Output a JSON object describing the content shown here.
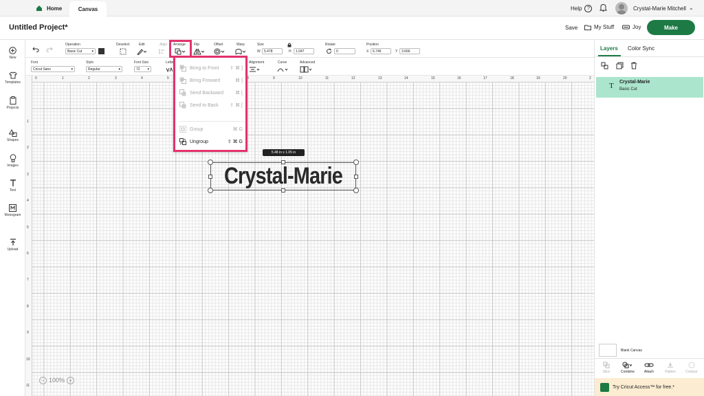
{
  "nav": {
    "home_label": "Home",
    "canvas_label": "Canvas",
    "help_label": "Help",
    "user_name": "Crystal-Marie Mitchell"
  },
  "project": {
    "title": "Untitled Project*",
    "save_label": "Save",
    "mystuff_label": "My Stuff",
    "joy_label": "Joy",
    "make_label": "Make"
  },
  "sidebar": {
    "items": [
      "New",
      "Templates",
      "Projects",
      "Shapes",
      "Images",
      "Text",
      "Monogram",
      "Upload"
    ]
  },
  "toolbar1": {
    "operation_label": "Operation",
    "operation_value": "Basic Cut",
    "deselect_label": "Deselect",
    "edit_label": "Edit",
    "align_label": "Align",
    "arrange_label": "Arrange",
    "flip_label": "Flip",
    "offset_label": "Offset",
    "warp_label": "Warp",
    "size_label": "Size",
    "w_label": "W",
    "w_value": "5.478",
    "h_label": "H",
    "h_value": "1.047",
    "rotate_label": "Rotate",
    "rotate_value": "0",
    "position_label": "Position",
    "x_label": "X",
    "x_value": "6.746",
    "y_label": "Y",
    "y_value": "3.666"
  },
  "toolbar2": {
    "font_label": "Font",
    "font_value": "Cricut Sans",
    "style_label": "Style",
    "style_value": "Regular",
    "fontsize_label": "Font Size",
    "fontsize_value": "72",
    "letter_label": "Letter",
    "alignment_label": "Alignment",
    "curve_label": "Curve",
    "advanced_label": "Advanced"
  },
  "arrange_menu": {
    "items": [
      {
        "label": "Bring to Front",
        "shortcut": "⇧ ⌘ ]",
        "enabled": false
      },
      {
        "label": "Bring Forward",
        "shortcut": "⌘ ]",
        "enabled": false
      },
      {
        "label": "Send Backward",
        "shortcut": "⌘ [",
        "enabled": false
      },
      {
        "label": "Send to Back",
        "shortcut": "⇧ ⌘ [",
        "enabled": false
      },
      {
        "label": "Group",
        "shortcut": "⌘ G",
        "enabled": false
      },
      {
        "label": "Ungroup",
        "shortcut": "⇧ ⌘ G",
        "enabled": true
      }
    ]
  },
  "canvas": {
    "ruler_top": [
      "0",
      "1",
      "2",
      "3",
      "4",
      "5",
      "6",
      "7",
      "8",
      "9",
      "10",
      "11",
      "12",
      "13",
      "14",
      "15",
      "16",
      "17",
      "18",
      "19",
      "20",
      "2"
    ],
    "ruler_left": [
      "1",
      "2",
      "3",
      "4",
      "5",
      "6",
      "7",
      "8",
      "9",
      "10",
      "11"
    ],
    "dimension_badge": "5.48  in x 1.05  in",
    "text_object": "Crystal-Marie",
    "zoom_value": "100%"
  },
  "right_panel": {
    "tabs": [
      "Layers",
      "Color Sync"
    ],
    "layer_name": "Crystal-Marie",
    "layer_sub": "Basic Cut",
    "blank_canvas_label": "Blank Canvas",
    "actions": [
      "Slice",
      "Combine",
      "Attach",
      "Flatten",
      "Contour"
    ],
    "promo_text": "Try Cricut Access™ for free.*"
  },
  "colors": {
    "accent": "#1d7a45",
    "highlight": "#e2336b",
    "layer_selected": "#abe5cd"
  }
}
